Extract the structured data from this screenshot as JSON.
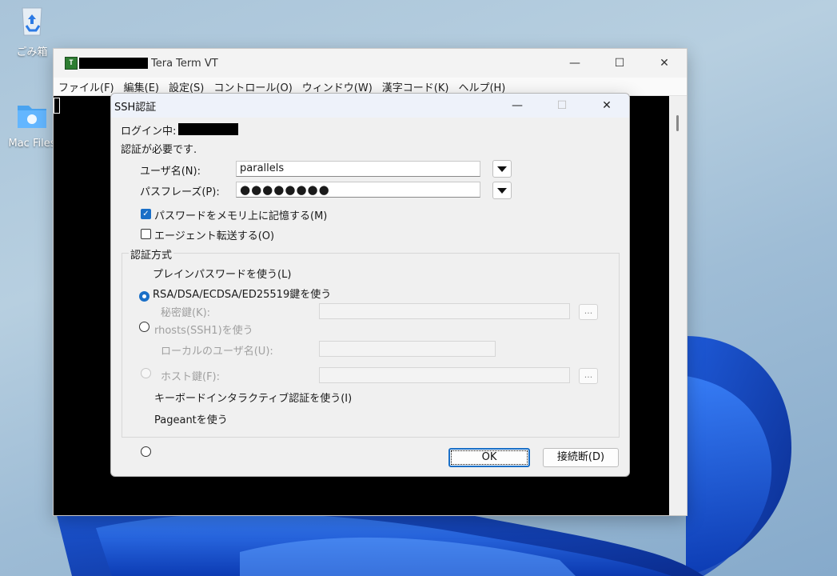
{
  "desktop": {
    "icons": [
      {
        "label": "ごみ箱"
      },
      {
        "label": "Mac Files"
      }
    ]
  },
  "window": {
    "title": "Tera Term VT",
    "menu": [
      "ファイル(F)",
      "編集(E)",
      "設定(S)",
      "コントロール(O)",
      "ウィンドウ(W)",
      "漢字コード(K)",
      "ヘルプ(H)"
    ],
    "controls": {
      "minimize": "—",
      "maximize": "☐",
      "close": "✕"
    }
  },
  "dialog": {
    "title": "SSH認証",
    "login_label": "ログイン中:",
    "auth_required": "認証が必要です.",
    "username_label": "ユーザ名(N):",
    "username_value": "parallels",
    "passphrase_label": "パスフレーズ(P):",
    "passphrase_value": "●●●●●●●●",
    "remember_password": {
      "label": "パスワードをメモリ上に記憶する(M)",
      "checked": true
    },
    "agent_forward": {
      "label": "エージェント転送する(O)",
      "checked": false
    },
    "auth_method_group": "認証方式",
    "methods": [
      {
        "label": "プレインパスワードを使う(L)",
        "selected": true
      },
      {
        "label": "RSA/DSA/ECDSA/ED25519鍵を使う",
        "selected": false
      },
      {
        "label": "rhosts(SSH1)を使う",
        "selected": false
      },
      {
        "label": "キーボードインタラクティブ認証を使う(I)",
        "selected": false
      },
      {
        "label": "Pageantを使う",
        "selected": false
      }
    ],
    "private_key_label": "秘密鍵(K):",
    "local_user_label": "ローカルのユーザ名(U):",
    "host_key_label": "ホスト鍵(F):",
    "browse_label": "...",
    "ok_label": "OK",
    "disconnect_label": "接続断(D)",
    "controls": {
      "minimize": "—",
      "maximize": "☐",
      "close": "✕"
    }
  },
  "colors": {
    "accent": "#1a6fc7",
    "terminal_bg": "#000000"
  }
}
